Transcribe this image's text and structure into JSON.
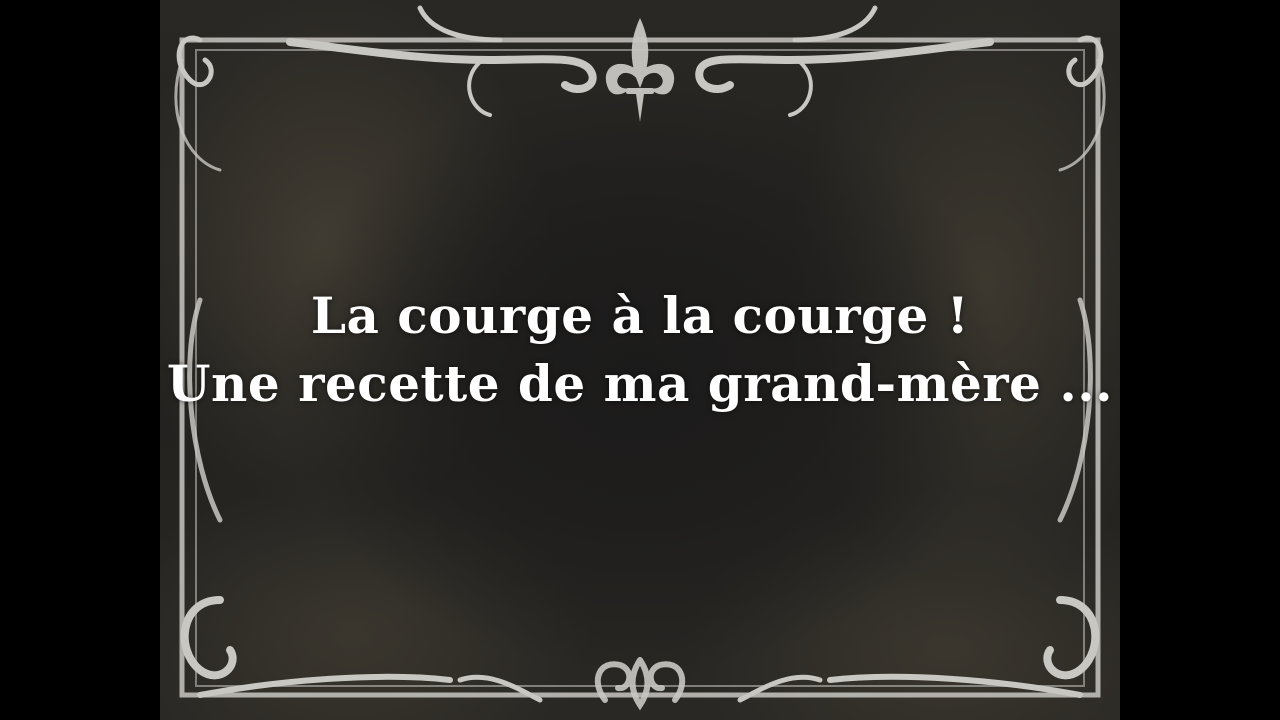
{
  "slide": {
    "line1": "La courge à la courge !",
    "line2": "Une recette de ma grand-mère ..."
  },
  "colors": {
    "background": "#000000",
    "card": "#22211f",
    "frame": "#c9c7c2",
    "text": "#ffffff"
  },
  "decorations": {
    "border": "ornamental-frame",
    "top_center": "fleur-de-lis-icon",
    "bottom_center": "scroll-ornament-icon"
  }
}
